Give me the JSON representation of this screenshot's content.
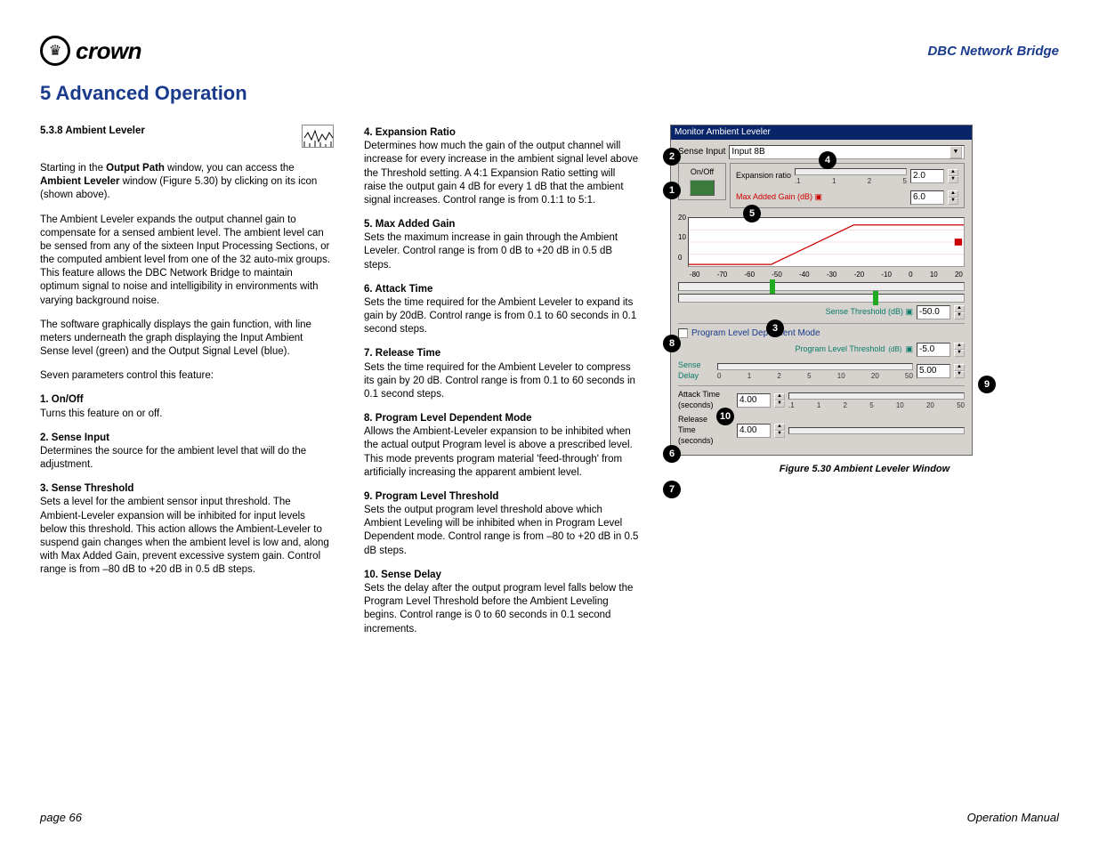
{
  "header": {
    "brand": "crown",
    "product": "DBC Network Bridge"
  },
  "title": "5 Advanced Operation",
  "section": {
    "number": "5.3.8",
    "name": "Ambient Leveler"
  },
  "col1": {
    "intro1a": "Starting in the ",
    "intro1b": "Output Path",
    "intro1c": " window, you can access the ",
    "intro1d": "Ambient Leveler",
    "intro1e": " window (Figure 5.30) by clicking on its icon (shown above).",
    "p2": "The Ambient Leveler expands the output channel gain to compensate for a sensed ambient level. The ambient level can be sensed from any of the sixteen Input Processing Sections, or the computed ambient level from one of the 32 auto-mix groups. This feature allows the DBC Network Bridge to maintain optimum signal to noise and intelligibility in environments with varying background noise.",
    "p3": "The software graphically displays the gain function, with line meters underneath the graph displaying the Input Ambient Sense level (green) and the Output Signal Level (blue).",
    "p4": "Seven parameters control this feature:",
    "h1": "1. On/Off",
    "t1": "Turns this feature on or off.",
    "h2": "2. Sense Input",
    "t2": "Determines the source for the ambient level that will do the adjustment.",
    "h3": "3. Sense Threshold",
    "t3": "Sets a level for the ambient sensor input threshold. The Ambient-Leveler expansion will be inhibited for input levels below this threshold. This action allows the Ambient-Leveler to suspend gain changes when the ambient level is low and, along with Max Added Gain, prevent excessive system gain. Control range is from –80 dB to +20 dB in 0.5 dB steps."
  },
  "col2": {
    "h4": "4. Expansion Ratio",
    "t4": "Determines how much the gain of the output channel will increase for every increase in the ambient signal level above the Threshold setting. A 4:1 Expansion Ratio setting will raise the output gain 4 dB for every 1 dB that the ambient signal increases. Control range is from 0.1:1 to 5:1.",
    "h5": "5. Max Added Gain",
    "t5": "Sets the maximum increase in gain through the Ambient Leveler. Control range is from 0 dB to +20 dB in 0.5 dB steps.",
    "h6": "6. Attack Time",
    "t6": "Sets the time required for the Ambient Leveler to expand its gain by 20dB. Control range is from 0.1 to 60 seconds in 0.1 second steps.",
    "h7": "7. Release Time",
    "t7": "Sets the time required for the Ambient Leveler to compress its gain by 20 dB. Control range is from 0.1 to 60 seconds in 0.1 second steps.",
    "h8": "8. Program Level Dependent Mode",
    "t8": "Allows the Ambient-Leveler expansion to be inhibited when the actual output Program level is above a prescribed level. This mode prevents program material 'feed-through' from artificially increasing the apparent ambient level.",
    "h9": "9. Program Level Threshold",
    "t9": "Sets the output program level threshold above which Ambient Leveling will be inhibited when in Program Level Dependent mode. Control range is from –80 to +20 dB in 0.5 dB steps.",
    "h10": "10. Sense Delay",
    "t10": "Sets the delay after the output program level falls below the Program Level Threshold before the Ambient Leveling begins. Control range is 0 to 60 seconds in 0.1 second increments."
  },
  "window": {
    "title": "Monitor Ambient Leveler",
    "sense_input_label": "Sense Input",
    "sense_input_value": "Input 8B",
    "onoff_label": "On/Off",
    "expansion_label": "Expansion ratio",
    "expansion_ticks": [
      ".1",
      "1",
      "2",
      "5"
    ],
    "expansion_value": "2.0",
    "max_added_label": "Max Added Gain (dB)",
    "max_added_value": "6.0",
    "graph_y": [
      "20",
      "10",
      "0"
    ],
    "graph_x": [
      "-80",
      "-70",
      "-60",
      "-50",
      "-40",
      "-30",
      "-20",
      "-10",
      "0",
      "10",
      "20"
    ],
    "sense_threshold_label": "Sense Threshold (dB)",
    "sense_threshold_value": "-50.0",
    "pldm_label": "Program Level Dependent Mode",
    "plt_label": "Program Level Threshold",
    "plt_unit": "(dB)",
    "plt_value": "-5.0",
    "sense_delay_label": "Sense\nDelay",
    "sense_delay_ticks": [
      "0",
      "1",
      "2",
      "5",
      "10",
      "20",
      "50"
    ],
    "sense_delay_value": "5.00",
    "attack_label": "Attack Time\n(seconds)",
    "attack_value": "4.00",
    "attack_ticks": [
      ".1",
      "1",
      "2",
      "5",
      "10",
      "20",
      "50"
    ],
    "release_label": "Release\nTime\n(seconds)",
    "release_value": "4.00"
  },
  "callouts": [
    "1",
    "2",
    "3",
    "4",
    "5",
    "6",
    "7",
    "8",
    "9",
    "10"
  ],
  "figure_caption": "Figure 5.30  Ambient Leveler Window",
  "footer": {
    "left": "page 66",
    "right": "Operation Manual"
  }
}
